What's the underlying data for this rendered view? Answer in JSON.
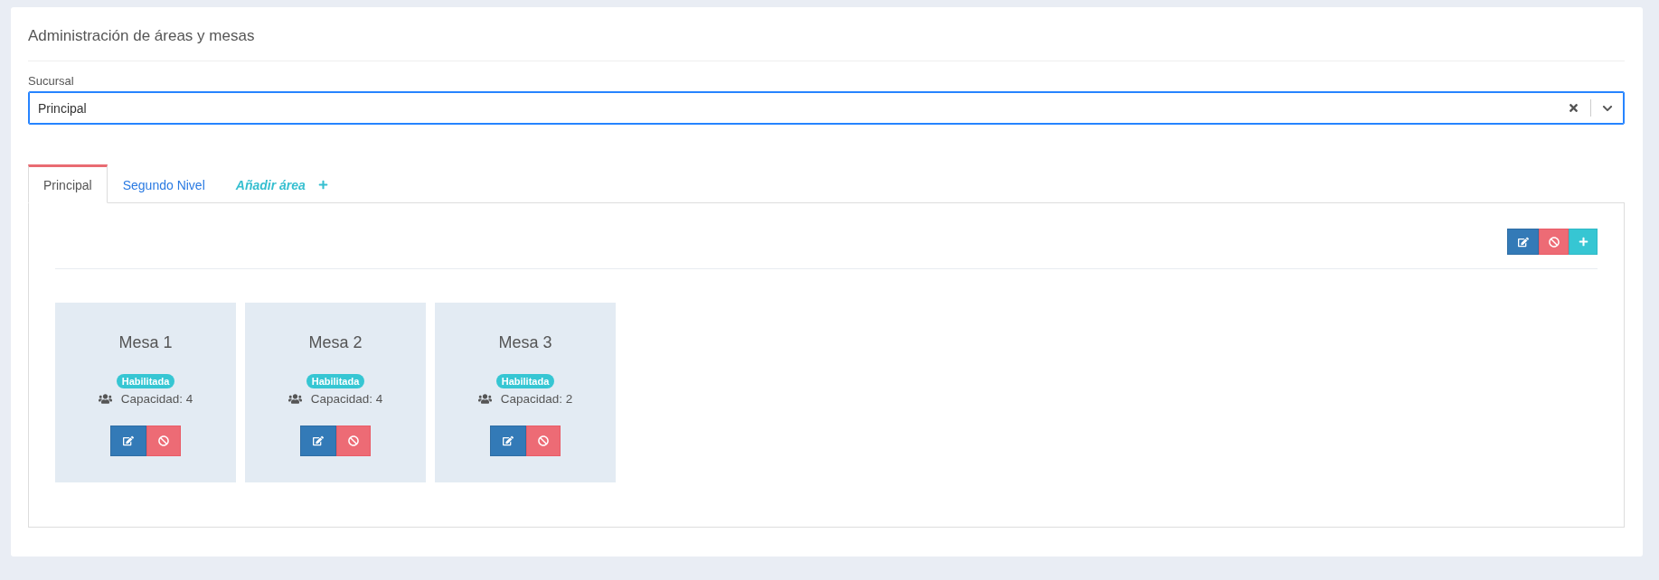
{
  "page": {
    "title": "Administración de áreas y mesas"
  },
  "branch_select": {
    "label": "Sucursal",
    "value": "Principal",
    "focused": true
  },
  "tabs": [
    {
      "label": "Principal",
      "kind": "area",
      "selected": true
    },
    {
      "label": "Segundo Nivel",
      "kind": "area",
      "selected": false
    },
    {
      "label": "Añadir área",
      "kind": "add",
      "selected": false
    }
  ],
  "toolbar": [
    {
      "kind": "edit"
    },
    {
      "kind": "disable"
    },
    {
      "kind": "add"
    }
  ],
  "tables": [
    {
      "name": "Mesa 1",
      "status": "Habilitada",
      "capacity": "Capacidad: 4",
      "actions": [
        {
          "kind": "edit"
        },
        {
          "kind": "disable"
        }
      ]
    },
    {
      "name": "Mesa 2",
      "status": "Habilitada",
      "capacity": "Capacidad: 4",
      "actions": [
        {
          "kind": "edit"
        },
        {
          "kind": "disable"
        }
      ]
    },
    {
      "name": "Mesa 3",
      "status": "Habilitada",
      "capacity": "Capacidad: 2",
      "actions": [
        {
          "kind": "edit"
        },
        {
          "kind": "disable"
        }
      ]
    }
  ]
}
